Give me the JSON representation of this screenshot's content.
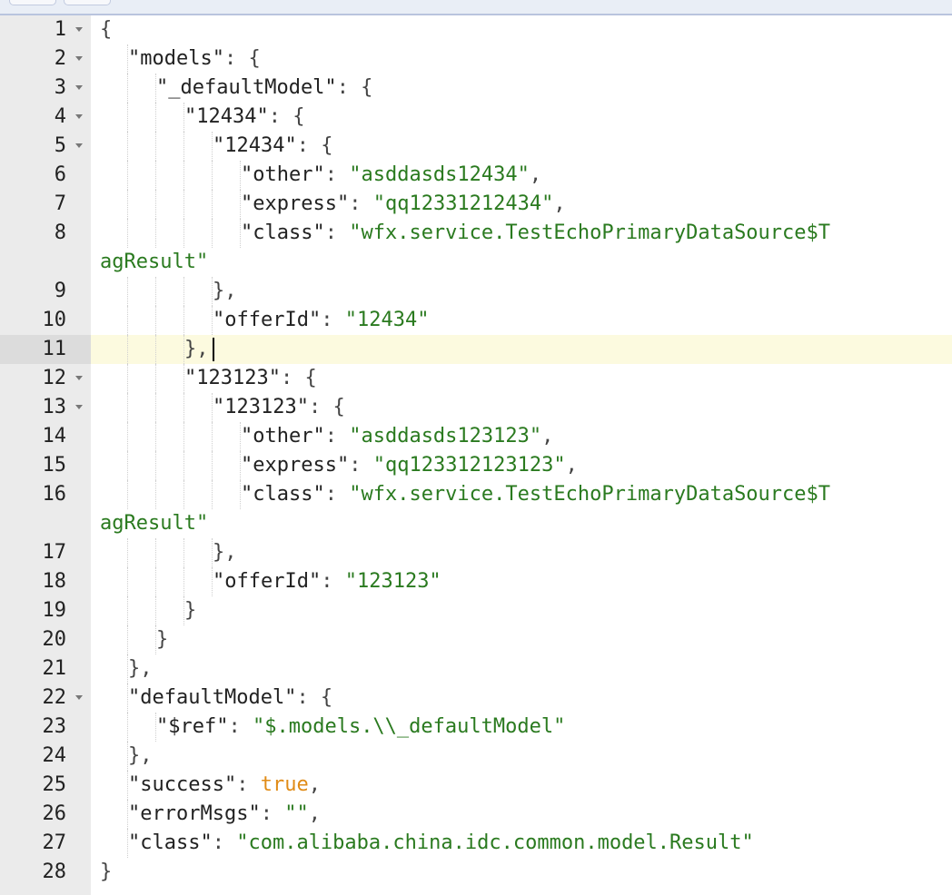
{
  "editor": {
    "lines": [
      {
        "n": "1",
        "fold": true,
        "indent": 0,
        "tokens": [
          {
            "t": "p",
            "v": "{"
          }
        ]
      },
      {
        "n": "2",
        "fold": true,
        "indent": 1,
        "tokens": [
          {
            "t": "k",
            "v": "\"models\""
          },
          {
            "t": "p",
            "v": ": {"
          }
        ]
      },
      {
        "n": "3",
        "fold": true,
        "indent": 2,
        "tokens": [
          {
            "t": "k",
            "v": "\"_defaultModel\""
          },
          {
            "t": "p",
            "v": ": {"
          }
        ]
      },
      {
        "n": "4",
        "fold": true,
        "indent": 3,
        "tokens": [
          {
            "t": "k",
            "v": "\"12434\""
          },
          {
            "t": "p",
            "v": ": {"
          }
        ]
      },
      {
        "n": "5",
        "fold": true,
        "indent": 4,
        "tokens": [
          {
            "t": "k",
            "v": "\"12434\""
          },
          {
            "t": "p",
            "v": ": {"
          }
        ]
      },
      {
        "n": "6",
        "fold": false,
        "indent": 5,
        "tokens": [
          {
            "t": "k",
            "v": "\"other\""
          },
          {
            "t": "p",
            "v": ": "
          },
          {
            "t": "s",
            "v": "\"asddasds12434\""
          },
          {
            "t": "p",
            "v": ","
          }
        ]
      },
      {
        "n": "7",
        "fold": false,
        "indent": 5,
        "tokens": [
          {
            "t": "k",
            "v": "\"express\""
          },
          {
            "t": "p",
            "v": ": "
          },
          {
            "t": "s",
            "v": "\"qq12331212434\""
          },
          {
            "t": "p",
            "v": ","
          }
        ]
      },
      {
        "n": "8",
        "fold": false,
        "indent": 5,
        "tokens": [
          {
            "t": "k",
            "v": "\"class\""
          },
          {
            "t": "p",
            "v": ": "
          },
          {
            "t": "s",
            "v": "\"wfx.service.TestEchoPrimaryDataSource$T"
          }
        ],
        "wrap": "agResult\""
      },
      {
        "n": "9",
        "fold": false,
        "indent": 4,
        "tokens": [
          {
            "t": "p",
            "v": "},"
          }
        ]
      },
      {
        "n": "10",
        "fold": false,
        "indent": 4,
        "tokens": [
          {
            "t": "k",
            "v": "\"offerId\""
          },
          {
            "t": "p",
            "v": ": "
          },
          {
            "t": "s",
            "v": "\"12434\""
          }
        ]
      },
      {
        "n": "11",
        "fold": false,
        "indent": 3,
        "active": true,
        "tokens": [
          {
            "t": "p",
            "v": "},"
          }
        ]
      },
      {
        "n": "12",
        "fold": true,
        "indent": 3,
        "tokens": [
          {
            "t": "k",
            "v": "\"123123\""
          },
          {
            "t": "p",
            "v": ": {"
          }
        ]
      },
      {
        "n": "13",
        "fold": true,
        "indent": 4,
        "tokens": [
          {
            "t": "k",
            "v": "\"123123\""
          },
          {
            "t": "p",
            "v": ": {"
          }
        ]
      },
      {
        "n": "14",
        "fold": false,
        "indent": 5,
        "tokens": [
          {
            "t": "k",
            "v": "\"other\""
          },
          {
            "t": "p",
            "v": ": "
          },
          {
            "t": "s",
            "v": "\"asddasds123123\""
          },
          {
            "t": "p",
            "v": ","
          }
        ]
      },
      {
        "n": "15",
        "fold": false,
        "indent": 5,
        "tokens": [
          {
            "t": "k",
            "v": "\"express\""
          },
          {
            "t": "p",
            "v": ": "
          },
          {
            "t": "s",
            "v": "\"qq123312123123\""
          },
          {
            "t": "p",
            "v": ","
          }
        ]
      },
      {
        "n": "16",
        "fold": false,
        "indent": 5,
        "tokens": [
          {
            "t": "k",
            "v": "\"class\""
          },
          {
            "t": "p",
            "v": ": "
          },
          {
            "t": "s",
            "v": "\"wfx.service.TestEchoPrimaryDataSource$T"
          }
        ],
        "wrap": "agResult\""
      },
      {
        "n": "17",
        "fold": false,
        "indent": 4,
        "tokens": [
          {
            "t": "p",
            "v": "},"
          }
        ]
      },
      {
        "n": "18",
        "fold": false,
        "indent": 4,
        "tokens": [
          {
            "t": "k",
            "v": "\"offerId\""
          },
          {
            "t": "p",
            "v": ": "
          },
          {
            "t": "s",
            "v": "\"123123\""
          }
        ]
      },
      {
        "n": "19",
        "fold": false,
        "indent": 3,
        "tokens": [
          {
            "t": "p",
            "v": "}"
          }
        ]
      },
      {
        "n": "20",
        "fold": false,
        "indent": 2,
        "tokens": [
          {
            "t": "p",
            "v": "}"
          }
        ]
      },
      {
        "n": "21",
        "fold": false,
        "indent": 1,
        "tokens": [
          {
            "t": "p",
            "v": "},"
          }
        ]
      },
      {
        "n": "22",
        "fold": true,
        "indent": 1,
        "tokens": [
          {
            "t": "k",
            "v": "\"defaultModel\""
          },
          {
            "t": "p",
            "v": ": {"
          }
        ]
      },
      {
        "n": "23",
        "fold": false,
        "indent": 2,
        "tokens": [
          {
            "t": "k",
            "v": "\"$ref\""
          },
          {
            "t": "p",
            "v": ": "
          },
          {
            "t": "s",
            "v": "\"$.models.\\\\_defaultModel\""
          }
        ]
      },
      {
        "n": "24",
        "fold": false,
        "indent": 1,
        "tokens": [
          {
            "t": "p",
            "v": "},"
          }
        ]
      },
      {
        "n": "25",
        "fold": false,
        "indent": 1,
        "tokens": [
          {
            "t": "k",
            "v": "\"success\""
          },
          {
            "t": "p",
            "v": ": "
          },
          {
            "t": "b",
            "v": "true"
          },
          {
            "t": "p",
            "v": ","
          }
        ]
      },
      {
        "n": "26",
        "fold": false,
        "indent": 1,
        "tokens": [
          {
            "t": "k",
            "v": "\"errorMsgs\""
          },
          {
            "t": "p",
            "v": ": "
          },
          {
            "t": "s",
            "v": "\"\""
          },
          {
            "t": "p",
            "v": ","
          }
        ]
      },
      {
        "n": "27",
        "fold": false,
        "indent": 1,
        "tokens": [
          {
            "t": "k",
            "v": "\"class\""
          },
          {
            "t": "p",
            "v": ": "
          },
          {
            "t": "s",
            "v": "\"com.alibaba.china.idc.common.model.Result\""
          }
        ]
      },
      {
        "n": "28",
        "fold": false,
        "indent": 0,
        "tokens": [
          {
            "t": "p",
            "v": "}"
          }
        ]
      }
    ]
  }
}
